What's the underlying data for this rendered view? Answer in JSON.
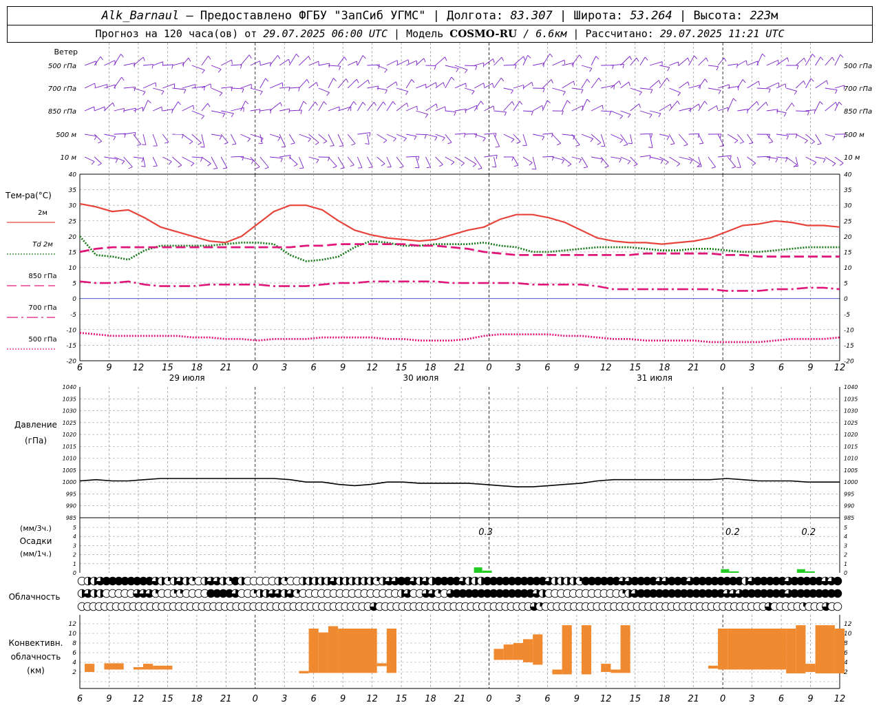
{
  "header": {
    "station": "Alk_Barnaul",
    "provider": "Предоставлено ФГБУ \"ЗапСиб УГМС\"",
    "lon_label": "Долгота:",
    "lon_value": "83.307",
    "lat_label": "Широта:",
    "lat_value": "53.264",
    "alt_label": "Высота:",
    "alt_value": "223",
    "alt_unit": "м",
    "forecast_label": "Прогноз на 120 часа(ов) от",
    "forecast_start": "29.07.2025 06:00 UTC",
    "model_label": "Модель",
    "model_name": "COSMO-RU",
    "model_res": "/ 6.6км",
    "computed_label": "Рассчитано:",
    "computed_time": "29.07.2025 11:21 UTC"
  },
  "colors": {
    "t2m": "#e8433a",
    "td2m": "#1a7a1a",
    "t850": "#e0157a",
    "t700": "#e0157a",
    "t500": "#e0157a",
    "wind": "#7a1fc8",
    "zero_line": "#3344cc",
    "pressure": "#000000",
    "precip": "#22cc22",
    "convective": "#f08a30",
    "grid": "#999999"
  },
  "chart_data": [
    {
      "type": "wind_barbs",
      "label": "Ветер",
      "levels": [
        "500 гПа",
        "700 гПа",
        "850 гПа",
        "500  м",
        "10   м"
      ],
      "x_hours": [
        0,
        120
      ]
    },
    {
      "type": "line",
      "label": "Тем-ра(°C)",
      "ylim": [
        -20,
        40
      ],
      "yticks": [
        40,
        35,
        30,
        25,
        20,
        15,
        10,
        5,
        0,
        -5,
        -10,
        -15,
        -20
      ],
      "x_ticks": [
        "6",
        "9",
        "12",
        "15",
        "18",
        "21",
        "0",
        "3",
        "6",
        "9",
        "12",
        "15",
        "18",
        "21",
        "0",
        "3",
        "6",
        "9",
        "12",
        "15",
        "18",
        "21",
        "0",
        "3",
        "6",
        "9",
        "12"
      ],
      "day_labels": [
        "29 июля",
        "30 июля",
        "31 июля"
      ],
      "x_hours_step": 3,
      "series": [
        {
          "name": "2м",
          "style": "solid",
          "key": "t2m",
          "values": [
            30.5,
            29.5,
            28,
            28.5,
            26,
            23,
            21.5,
            20,
            18.5,
            18,
            20,
            24,
            28,
            30,
            30,
            28.5,
            25,
            22,
            20.5,
            19.5,
            19,
            18.5,
            19,
            20.5,
            22,
            23,
            25.5,
            27,
            27,
            26,
            24.5,
            22,
            19.5,
            18.5,
            18,
            18,
            17.5,
            18,
            18.5,
            19.5,
            21.5,
            23.5,
            24,
            25,
            24.5,
            23.5,
            23.5,
            23
          ]
        },
        {
          "name": "Td 2м",
          "style": "dotted",
          "key": "td2m",
          "values": [
            20,
            14,
            13.5,
            12.5,
            15.5,
            17,
            17,
            17,
            17,
            17.5,
            18,
            18,
            17.5,
            14,
            12,
            12.5,
            13.5,
            16.5,
            18.5,
            18,
            17,
            17,
            17.5,
            17.5,
            17.5,
            18,
            17,
            16.5,
            15,
            15,
            15.5,
            16,
            16.5,
            16.5,
            16.5,
            16,
            15.5,
            15.5,
            16,
            16,
            15.5,
            15,
            15,
            15.5,
            16,
            16.5,
            16.5,
            16.5
          ]
        },
        {
          "name": "850 гПа",
          "style": "dashed",
          "key": "t850",
          "values": [
            15,
            16,
            16.5,
            16.5,
            16.5,
            16.5,
            16.5,
            16.5,
            16.5,
            16.5,
            16.5,
            16.5,
            16.5,
            16.5,
            17,
            17,
            17.5,
            17.5,
            17.5,
            17.5,
            17.5,
            17,
            17,
            16.5,
            16,
            15,
            14.5,
            14,
            14,
            14,
            14,
            14,
            14,
            14,
            14,
            14.5,
            14.5,
            14.5,
            14.5,
            14.5,
            14,
            14,
            13.5,
            13.5,
            13.5,
            13.5,
            13.5,
            13.5
          ]
        },
        {
          "name": "700 гПа",
          "style": "dashdot",
          "key": "t700",
          "values": [
            5.5,
            5,
            5,
            5.5,
            4.5,
            4,
            4,
            4,
            4.5,
            4.5,
            4.5,
            4.5,
            4,
            4,
            4,
            4.5,
            5,
            5,
            5.5,
            5.5,
            5.5,
            5.5,
            5.5,
            5,
            5,
            5,
            5,
            5,
            4.5,
            4.5,
            4.5,
            4.5,
            4,
            3,
            3,
            3,
            3,
            3,
            3,
            3,
            2.5,
            2.5,
            2.5,
            3,
            3,
            3.5,
            3.5,
            3
          ]
        },
        {
          "name": "500 гПа",
          "style": "dotted",
          "key": "t500",
          "values": [
            -11,
            -11.5,
            -12,
            -12,
            -12,
            -12,
            -12,
            -12.5,
            -12.5,
            -13,
            -13,
            -13.5,
            -13,
            -13,
            -13,
            -12.5,
            -12.5,
            -12.5,
            -12.5,
            -13,
            -13,
            -13.5,
            -13.5,
            -13.5,
            -13,
            -12,
            -11.5,
            -11.5,
            -11.5,
            -11.5,
            -12,
            -12,
            -12.5,
            -13,
            -13,
            -13.5,
            -13.5,
            -13.5,
            -13.5,
            -14,
            -14,
            -14,
            -14,
            -13.5,
            -13,
            -13,
            -13,
            -12.5
          ]
        }
      ]
    },
    {
      "type": "line",
      "label1": "Давление",
      "label2": "(гПа)",
      "ylim": [
        985,
        1040
      ],
      "yticks": [
        1040,
        1035,
        1030,
        1025,
        1020,
        1015,
        1010,
        1005,
        1000,
        995,
        990,
        985
      ],
      "series": [
        {
          "key": "pressure",
          "values": [
            1000.5,
            1001,
            1000.5,
            1000.5,
            1001,
            1001.5,
            1001.5,
            1001.5,
            1001.5,
            1001.5,
            1001.5,
            1001.5,
            1001.5,
            1001,
            1000,
            1000,
            999,
            998.5,
            999,
            1000,
            1000,
            999.5,
            999.5,
            999.5,
            999.5,
            999,
            998.5,
            998,
            998,
            998.5,
            999,
            999.5,
            1000.5,
            1001,
            1001,
            1001,
            1001,
            1001,
            1001,
            1001,
            1001.5,
            1001,
            1000.5,
            1000.5,
            1000.5,
            1000,
            1000,
            1000
          ]
        }
      ]
    },
    {
      "type": "bar",
      "label1": "(мм/3ч.)",
      "label2": "Осадки",
      "label3": "(мм/1ч.)",
      "ylim": [
        0,
        5
      ],
      "yticks": [
        5,
        4,
        3,
        2,
        1,
        0
      ],
      "bars": [
        {
          "hour": 63,
          "value": 0.3,
          "label": "0.3"
        },
        {
          "hour": 102,
          "value": 0.2,
          "label": "0.2"
        },
        {
          "hour": 114,
          "value": 0.2,
          "label": "0.2"
        }
      ]
    },
    {
      "type": "table",
      "label": "Облачность",
      "rows": 3,
      "cover_levels": [
        0,
        0.25,
        0.5,
        0.75,
        1
      ],
      "row_values": [
        [
          0,
          0.5,
          0.5,
          0.75,
          1,
          1,
          1,
          1,
          1,
          1,
          1,
          1,
          0.75,
          0.5,
          0.25,
          0.5,
          0.75,
          0.5,
          0.25,
          0,
          0.5,
          0.75,
          0.75,
          0.5,
          0.25,
          1,
          0.5,
          0,
          0,
          0,
          0,
          0,
          0.5,
          0.25,
          0,
          0,
          0.5,
          0.5,
          0.5,
          0.5,
          0.5,
          0.75,
          0.5,
          0.5,
          0.5,
          0.5,
          0.5,
          0.5,
          0.25,
          0.5,
          0.75,
          0.75,
          1,
          1,
          0.75,
          0.5,
          0.75,
          0.5,
          1,
          1,
          1,
          1,
          0.75,
          0.5,
          0.5,
          0.5,
          1,
          1,
          1,
          1,
          1,
          1,
          1,
          1,
          1,
          1,
          0.75,
          0.5,
          0.5,
          0.5,
          0.5,
          0.25,
          1,
          1,
          1,
          1,
          1,
          1,
          0.75,
          0.75,
          1,
          1,
          1,
          1,
          0.75,
          0.75,
          1,
          1,
          1,
          0.75,
          1,
          1,
          1,
          1,
          1,
          1,
          1,
          1,
          0.5,
          0.75,
          1,
          1,
          1,
          1,
          1,
          0.75,
          1,
          1,
          1,
          1,
          1,
          0.75,
          0.75,
          1
        ],
        [
          0.5,
          0.75,
          0.5,
          0.5,
          0,
          0,
          0,
          0,
          0,
          0.75,
          0.75,
          0.75,
          0.25,
          0,
          0,
          0.25,
          0.25,
          0,
          0,
          0,
          0,
          1,
          1,
          1,
          1,
          0.75,
          0,
          0,
          0.25,
          0.5,
          0.5,
          0.75,
          0.75,
          0.5,
          0.75,
          0.25,
          0,
          0,
          0,
          0,
          0,
          0,
          0,
          0,
          0,
          0,
          0,
          0,
          0,
          0,
          0,
          0,
          0.5,
          0.75,
          0,
          0,
          0.75,
          0.75,
          0.25,
          0,
          0.75,
          1,
          1,
          1,
          1,
          1,
          1,
          1,
          1,
          1,
          1,
          1,
          1,
          1,
          0.75,
          0.5,
          0,
          0,
          0,
          0,
          0,
          0,
          0,
          0,
          0,
          0,
          0,
          0,
          0.25,
          0.5,
          0.75,
          1,
          1,
          1,
          1,
          1,
          1,
          1,
          1,
          1,
          1,
          1,
          1,
          1,
          1,
          0.75,
          0.75,
          0.75,
          1,
          1,
          1,
          1,
          1,
          1,
          1,
          0.75,
          1,
          1,
          1,
          1,
          1,
          1,
          1,
          1
        ],
        [
          0,
          0,
          0,
          0,
          0,
          0,
          0,
          0,
          0,
          0,
          0,
          0,
          0,
          0,
          0,
          0,
          0,
          0,
          0,
          0,
          0,
          0,
          0,
          0,
          0,
          0,
          0,
          0,
          0,
          0,
          0,
          0,
          0,
          0,
          0,
          0,
          0,
          0,
          0,
          0,
          0,
          0,
          0,
          0,
          0,
          0,
          0,
          0,
          0,
          0,
          0,
          0.75,
          0,
          0,
          0,
          0,
          0,
          0,
          0,
          0,
          0,
          0,
          0,
          0,
          0,
          0,
          0,
          0,
          0,
          0,
          0,
          0,
          0,
          0,
          0,
          0,
          0,
          0,
          0,
          0.75,
          0.25,
          0,
          0,
          0,
          0,
          0,
          0,
          0,
          0,
          0,
          0,
          0,
          0,
          0,
          0,
          0,
          0,
          0,
          0,
          0,
          0,
          0,
          0,
          0,
          0,
          0,
          0,
          0,
          0,
          0,
          0,
          0,
          0,
          0,
          0,
          0,
          0,
          0,
          0,
          0,
          0.75,
          0,
          0,
          0,
          0,
          0,
          0.25,
          0,
          0,
          0,
          0.75,
          0,
          0
        ]
      ]
    },
    {
      "type": "bar",
      "label1": "Конвективн.",
      "label2": "облачность",
      "label3": "(км)",
      "ylim": [
        0,
        13
      ],
      "yticks": [
        12,
        10,
        8,
        6,
        4,
        2,
        0
      ],
      "segments": [
        {
          "h0": 0.5,
          "h1": 1.5,
          "bottom": 2,
          "top": 3.7
        },
        {
          "h0": 2.5,
          "h1": 4.5,
          "bottom": 2.5,
          "top": 3.8
        },
        {
          "h0": 5.5,
          "h1": 6.5,
          "bottom": 2.5,
          "top": 3
        },
        {
          "h0": 6.5,
          "h1": 7.5,
          "bottom": 2.5,
          "top": 3.7
        },
        {
          "h0": 7.5,
          "h1": 9.5,
          "bottom": 2.5,
          "top": 3.3
        },
        {
          "h0": 22.5,
          "h1": 23.5,
          "bottom": 1.7,
          "top": 2.2
        },
        {
          "h0": 23.5,
          "h1": 24.5,
          "bottom": 1.8,
          "top": 11
        },
        {
          "h0": 24.5,
          "h1": 25.5,
          "bottom": 1.8,
          "top": 10.2
        },
        {
          "h0": 25.5,
          "h1": 26.5,
          "bottom": 1.8,
          "top": 11.5
        },
        {
          "h0": 26.5,
          "h1": 30.5,
          "bottom": 1.8,
          "top": 11
        },
        {
          "h0": 30.5,
          "h1": 31.5,
          "bottom": 3.2,
          "top": 3.8
        },
        {
          "h0": 31.5,
          "h1": 32.5,
          "bottom": 1.8,
          "top": 11
        },
        {
          "h0": 42.5,
          "h1": 43.5,
          "bottom": 4.5,
          "top": 6.8
        },
        {
          "h0": 43.5,
          "h1": 44.5,
          "bottom": 4.5,
          "top": 7.7
        },
        {
          "h0": 44.5,
          "h1": 45.5,
          "bottom": 4.5,
          "top": 8
        },
        {
          "h0": 45.5,
          "h1": 46.5,
          "bottom": 4,
          "top": 8.8
        },
        {
          "h0": 46.5,
          "h1": 47.5,
          "bottom": 3.5,
          "top": 9.8
        },
        {
          "h0": 48.5,
          "h1": 49.5,
          "bottom": 1.5,
          "top": 2.5
        },
        {
          "h0": 49.5,
          "h1": 50.5,
          "bottom": 1.5,
          "top": 11.7
        },
        {
          "h0": 51.5,
          "h1": 52.5,
          "bottom": 1.5,
          "top": 11.7
        },
        {
          "h0": 53.5,
          "h1": 54.5,
          "bottom": 2,
          "top": 3.7
        },
        {
          "h0": 54.5,
          "h1": 55.5,
          "bottom": 1.8,
          "top": 2.5
        },
        {
          "h0": 55.5,
          "h1": 56.5,
          "bottom": 1.8,
          "top": 11.7
        },
        {
          "h0": 64.5,
          "h1": 65.5,
          "bottom": 2.7,
          "top": 3.3
        },
        {
          "h0": 65.5,
          "h1": 66.5,
          "bottom": 2.5,
          "top": 11
        },
        {
          "h0": 66.5,
          "h1": 72.5,
          "bottom": 2.5,
          "top": 11
        },
        {
          "h0": 72.5,
          "h1": 73.5,
          "bottom": 1.7,
          "top": 11
        },
        {
          "h0": 73.5,
          "h1": 74.5,
          "bottom": 1.7,
          "top": 11.7
        },
        {
          "h0": 74.5,
          "h1": 75.5,
          "bottom": 2,
          "top": 3.7
        },
        {
          "h0": 75.5,
          "h1": 77.5,
          "bottom": 1.7,
          "top": 11.7
        },
        {
          "h0": 77.5,
          "h1": 78.5,
          "bottom": 1.7,
          "top": 11
        },
        {
          "h0": 0,
          "h1": 0,
          "bottom": 0,
          "top": 0
        }
      ]
    }
  ]
}
